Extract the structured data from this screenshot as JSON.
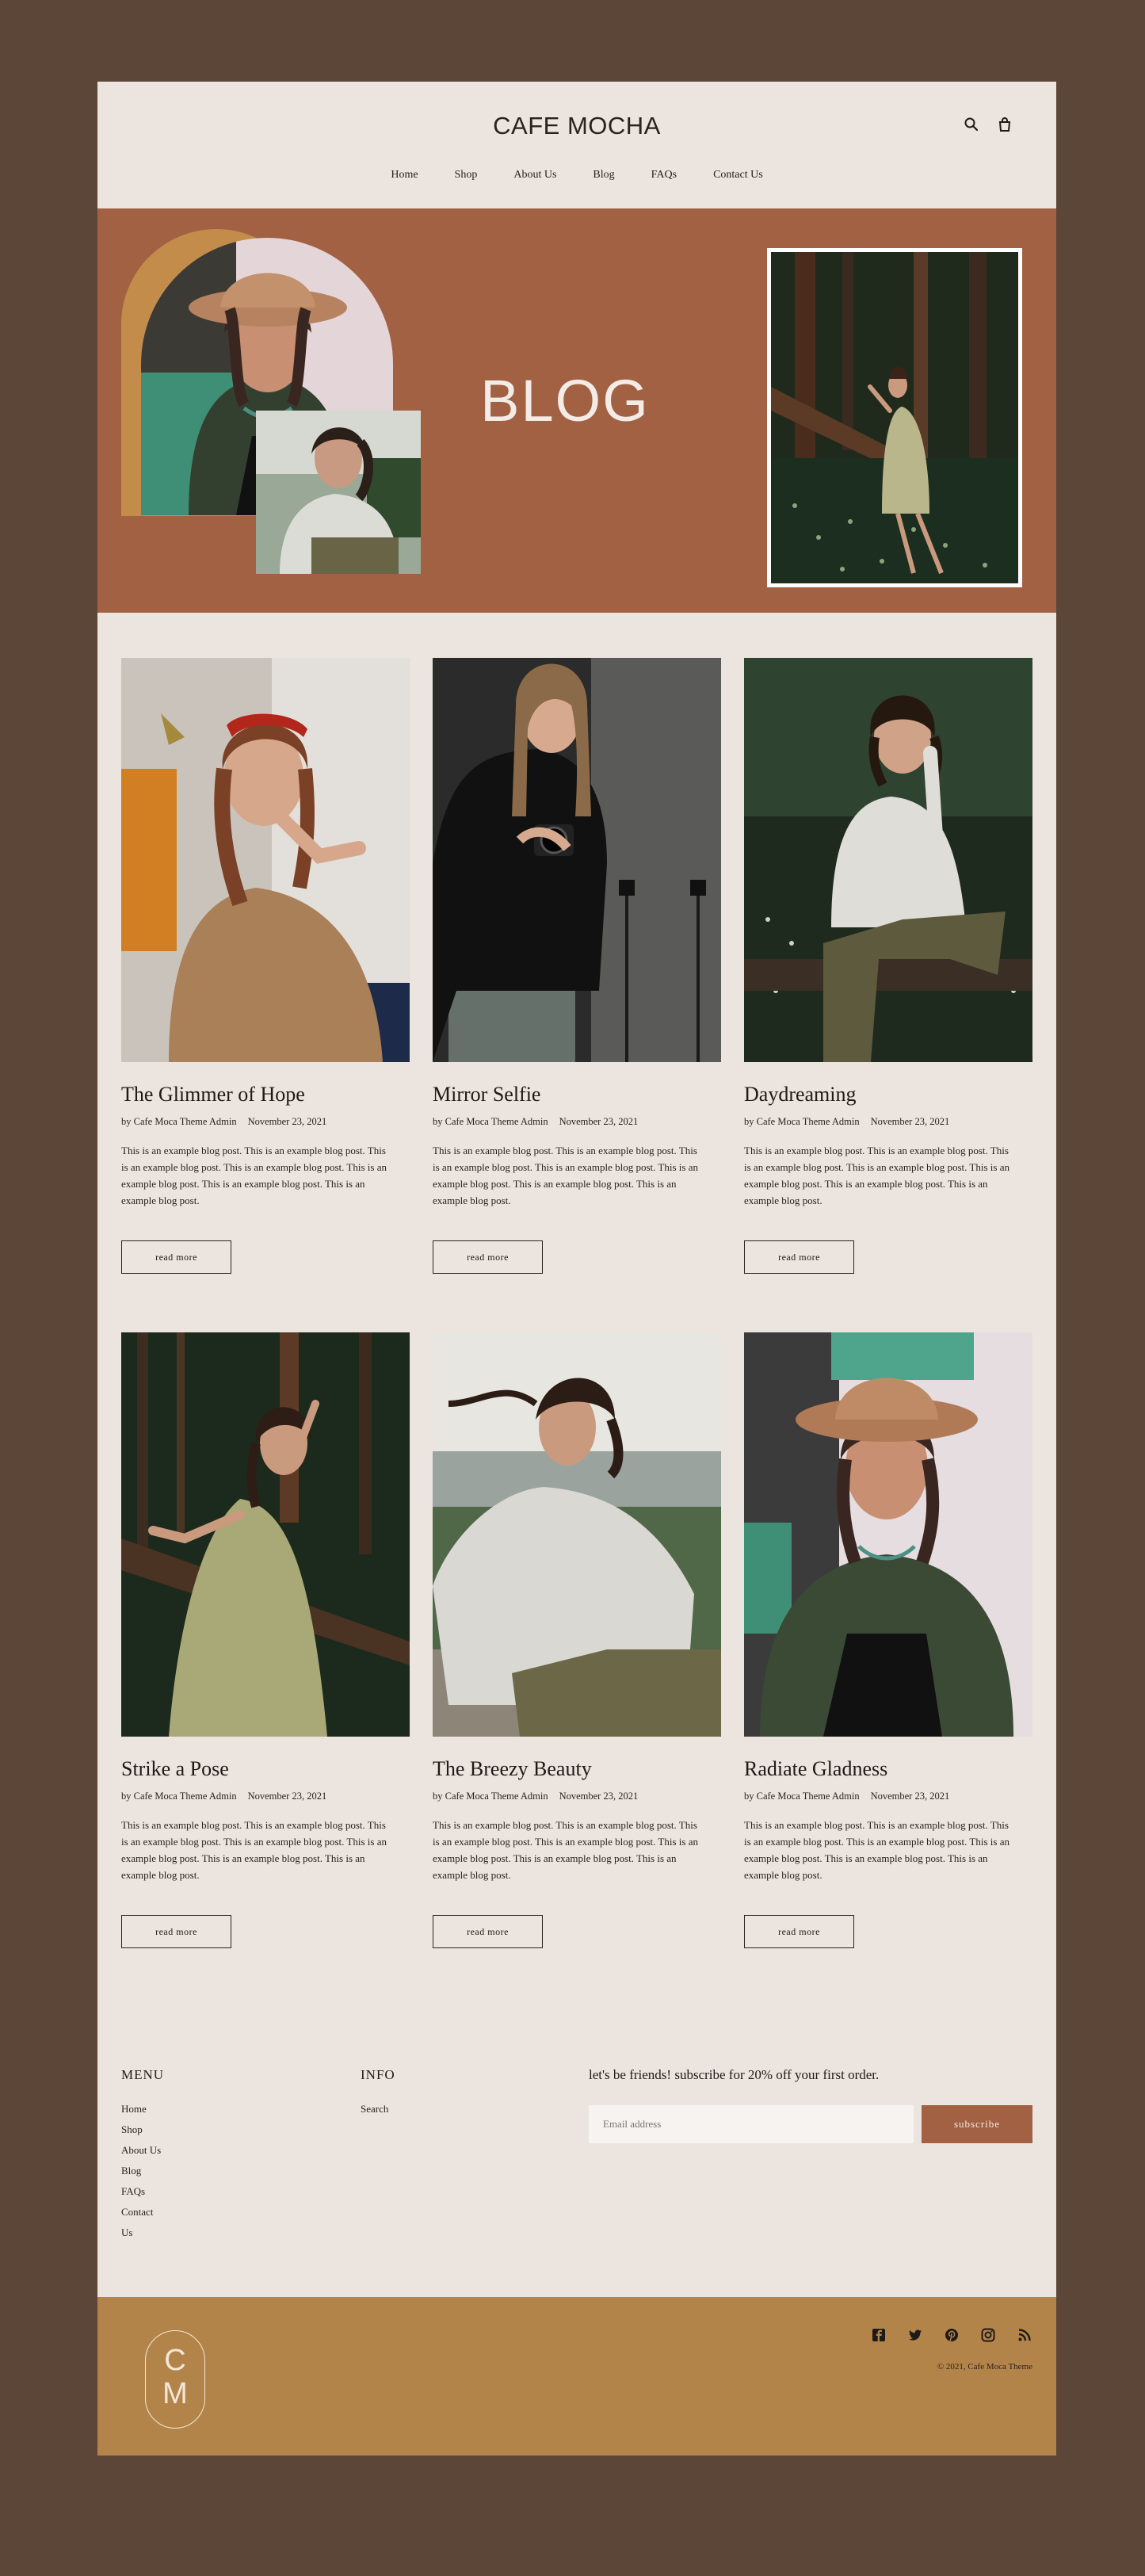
{
  "header": {
    "logo": "CAFE MOCHA",
    "nav": [
      "Home",
      "Shop",
      "About Us",
      "Blog",
      "FAQs",
      "Contact Us"
    ]
  },
  "hero": {
    "title": "BLOG"
  },
  "posts": [
    {
      "title": "The Glimmer of Hope",
      "author": "by Cafe Moca Theme Admin",
      "date": "November 23, 2021",
      "excerpt": "This is an example blog post. This is an example blog post. This is an example blog post. This is an example blog post. This is an example blog post. This is an example blog post. This is an example blog post.",
      "button": "read more"
    },
    {
      "title": "Mirror Selfie",
      "author": "by Cafe Moca Theme Admin",
      "date": "November 23, 2021",
      "excerpt": "This is an example blog post. This is an example blog post. This is an example blog post. This is an example blog post. This is an example blog post. This is an example blog post. This is an example blog post.",
      "button": "read more"
    },
    {
      "title": "Daydreaming",
      "author": "by Cafe Moca Theme Admin",
      "date": "November 23, 2021",
      "excerpt": "This is an example blog post. This is an example blog post. This is an example blog post. This is an example blog post. This is an example blog post. This is an example blog post. This is an example blog post.",
      "button": "read more"
    },
    {
      "title": "Strike a Pose",
      "author": "by Cafe Moca Theme Admin",
      "date": "November 23, 2021",
      "excerpt": "This is an example blog post. This is an example blog post. This is an example blog post. This is an example blog post. This is an example blog post. This is an example blog post. This is an example blog post.",
      "button": "read more"
    },
    {
      "title": "The Breezy Beauty",
      "author": "by Cafe Moca Theme Admin",
      "date": "November 23, 2021",
      "excerpt": "This is an example blog post. This is an example blog post. This is an example blog post. This is an example blog post. This is an example blog post. This is an example blog post. This is an example blog post.",
      "button": "read more"
    },
    {
      "title": "Radiate Gladness",
      "author": "by Cafe Moca Theme Admin",
      "date": "November 23, 2021",
      "excerpt": "This is an example blog post. This is an example blog post. This is an example blog post. This is an example blog post. This is an example blog post. This is an example blog post. This is an example blog post.",
      "button": "read more"
    }
  ],
  "footer": {
    "menu_title": "MENU",
    "menu": [
      "Home",
      "Shop",
      "About Us",
      "Blog",
      "FAQs",
      "Contact Us"
    ],
    "info_title": "INFO",
    "info": [
      "Search"
    ],
    "subscribe_text": "let's be friends! subscribe for 20% off your first order.",
    "email_placeholder": "Email address",
    "subscribe_button": "subscribe",
    "monogram_top": "C",
    "monogram_bottom": "M",
    "social_icons": [
      "facebook-icon",
      "twitter-icon",
      "pinterest-icon",
      "instagram-icon",
      "rss-icon"
    ],
    "copyright": "© 2021, Cafe Moca Theme"
  },
  "colors": {
    "page_bg": "#5b4637",
    "content_bg": "#ebe4df",
    "hero_bg": "#a26143",
    "footer_bar": "#b3844a",
    "accent_arch": "#c48c4a"
  },
  "icons": {
    "search": "search-icon",
    "cart": "cart-icon"
  }
}
